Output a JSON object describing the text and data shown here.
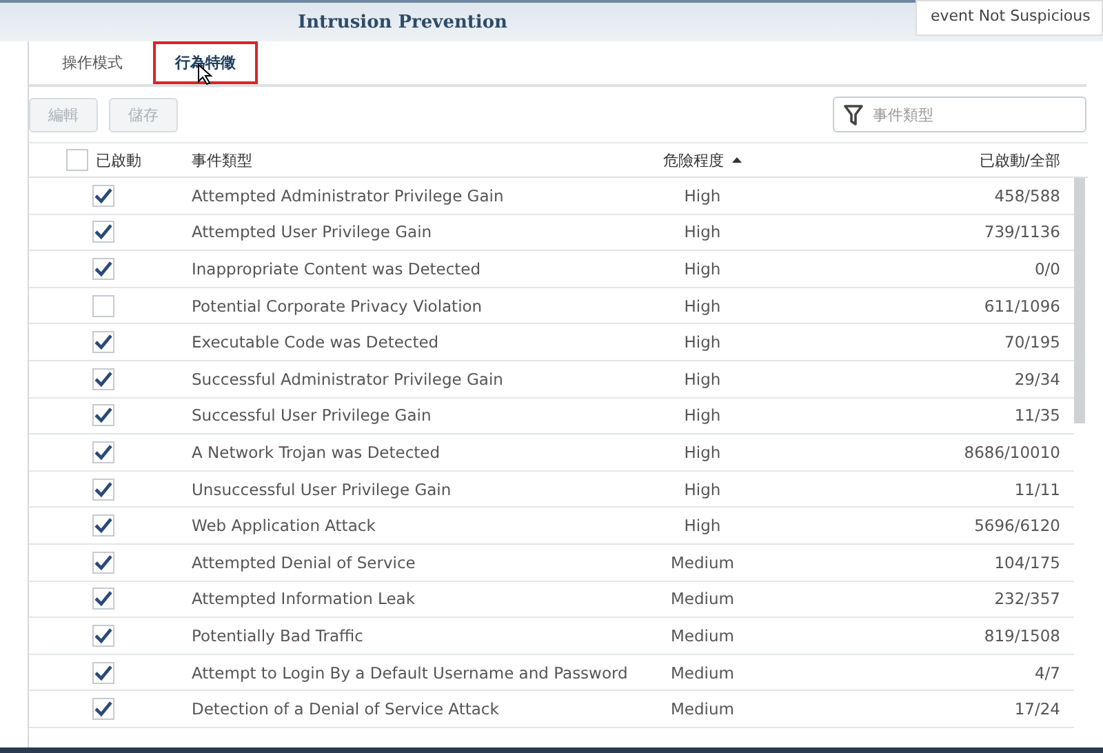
{
  "window": {
    "title": "Intrusion Prevention"
  },
  "tooltip": {
    "text": "event Not Suspicious"
  },
  "tabs": [
    {
      "label": "操作模式",
      "selected": false
    },
    {
      "label": "行為特徵",
      "selected": true
    }
  ],
  "toolbar": {
    "buttons": [
      {
        "label": "編輯",
        "disabled": true
      },
      {
        "label": "儲存",
        "disabled": true
      }
    ],
    "search": {
      "placeholder": "事件類型"
    }
  },
  "table": {
    "header_checked": false,
    "columns": [
      "已啟動",
      "事件類型",
      "危險程度",
      "已啟動/全部"
    ],
    "rows": [
      {
        "enabled": true,
        "event": "Attempted Administrator Privilege Gain",
        "severity": "High",
        "count": "458/588"
      },
      {
        "enabled": true,
        "event": "Attempted User Privilege Gain",
        "severity": "High",
        "count": "739/1136"
      },
      {
        "enabled": true,
        "event": "Inappropriate Content was Detected",
        "severity": "High",
        "count": "0/0"
      },
      {
        "enabled": false,
        "event": "Potential Corporate Privacy Violation",
        "severity": "High",
        "count": "611/1096"
      },
      {
        "enabled": true,
        "event": "Executable Code was Detected",
        "severity": "High",
        "count": "70/195"
      },
      {
        "enabled": true,
        "event": "Successful Administrator Privilege Gain",
        "severity": "High",
        "count": "29/34"
      },
      {
        "enabled": true,
        "event": "Successful User Privilege Gain",
        "severity": "High",
        "count": "11/35"
      },
      {
        "enabled": true,
        "event": "A Network Trojan was Detected",
        "severity": "High",
        "count": "8686/10010"
      },
      {
        "enabled": true,
        "event": "Unsuccessful User Privilege Gain",
        "severity": "High",
        "count": "11/11"
      },
      {
        "enabled": true,
        "event": "Web Application Attack",
        "severity": "High",
        "count": "5696/6120"
      },
      {
        "enabled": true,
        "event": "Attempted Denial of Service",
        "severity": "Medium",
        "count": "104/175"
      },
      {
        "enabled": true,
        "event": "Attempted Information Leak",
        "severity": "Medium",
        "count": "232/357"
      },
      {
        "enabled": true,
        "event": "Potentially Bad Traffic",
        "severity": "Medium",
        "count": "819/1508"
      },
      {
        "enabled": true,
        "event": "Attempt to Login By a Default Username and Password",
        "severity": "Medium",
        "count": "4/7"
      },
      {
        "enabled": true,
        "event": "Detection of a Denial of Service Attack",
        "severity": "Medium",
        "count": "17/24"
      }
    ]
  }
}
